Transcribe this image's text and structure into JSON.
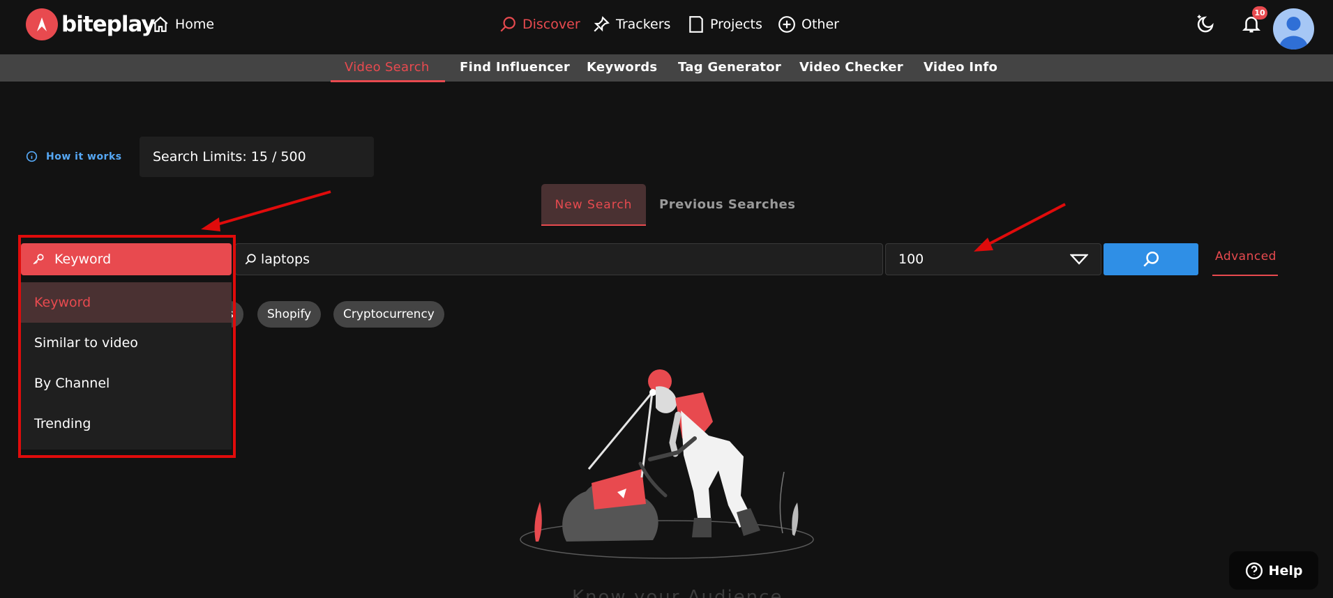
{
  "brand": {
    "name": "biteplay",
    "accent": "#e84a4f"
  },
  "topnav": {
    "home": "Home",
    "discover": "Discover",
    "trackers": "Trackers",
    "projects": "Projects",
    "other": "Other",
    "notifications_count": "10"
  },
  "subnav": {
    "items": [
      "Video Search",
      "Find Influencer",
      "Keywords",
      "Tag Generator",
      "Video Checker",
      "Video Info"
    ],
    "active": "Video Search"
  },
  "info": {
    "how_it_works": "How it works",
    "search_limits": "Search Limits: 15 / 500"
  },
  "tabs": {
    "new_search": "New Search",
    "previous_searches": "Previous Searches"
  },
  "search": {
    "type_selected": "Keyword",
    "query": "laptops",
    "result_count": "100",
    "advanced_label": "Advanced"
  },
  "chips": [
    "s",
    "Shopify",
    "Cryptocurrency"
  ],
  "dropdown": {
    "options": [
      "Keyword",
      "Similar to video",
      "By Channel",
      "Trending"
    ],
    "selected": "Keyword"
  },
  "footer": {
    "help": "Help",
    "tagline": "Know your Audience"
  },
  "colors": {
    "background": "#121212",
    "subnav": "#444444",
    "primary_blue": "#2f8fe6",
    "link_blue": "#56a8f5",
    "annotation_red": "#e00b0b"
  }
}
